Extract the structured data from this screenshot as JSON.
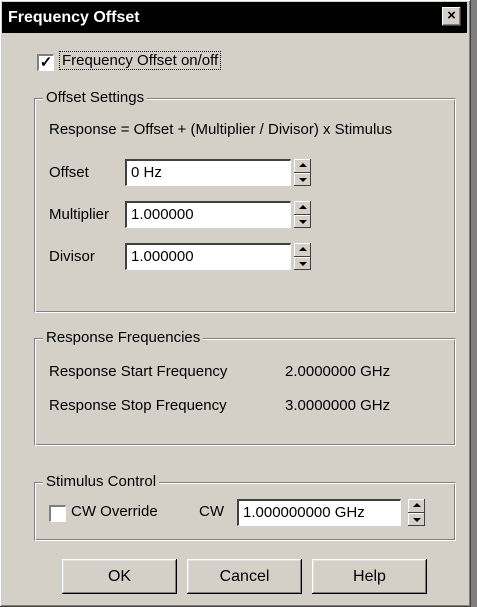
{
  "window": {
    "title": "Frequency Offset",
    "close_glyph": "×"
  },
  "enable": {
    "checked_glyph": "✓",
    "label": "Frequency Offset on/off"
  },
  "offset_settings": {
    "title": "Offset Settings",
    "formula": "Response  =  Offset + (Multiplier / Divisor) x Stimulus",
    "offset": {
      "label": "Offset",
      "value": "0 Hz"
    },
    "multiplier": {
      "label": "Multiplier",
      "value": "1.000000"
    },
    "divisor": {
      "label": "Divisor",
      "value": "1.000000"
    }
  },
  "response_frequencies": {
    "title": "Response Frequencies",
    "start": {
      "label": "Response Start Frequency",
      "value": "2.0000000 GHz"
    },
    "stop": {
      "label": "Response Stop Frequency",
      "value": "3.0000000 GHz"
    }
  },
  "stimulus_control": {
    "title": "Stimulus Control",
    "cw_override": {
      "label": "CW Override",
      "checked": false
    },
    "cw": {
      "label": "CW",
      "value": "1.000000000 GHz"
    }
  },
  "buttons": {
    "ok": "OK",
    "cancel": "Cancel",
    "help": "Help"
  }
}
